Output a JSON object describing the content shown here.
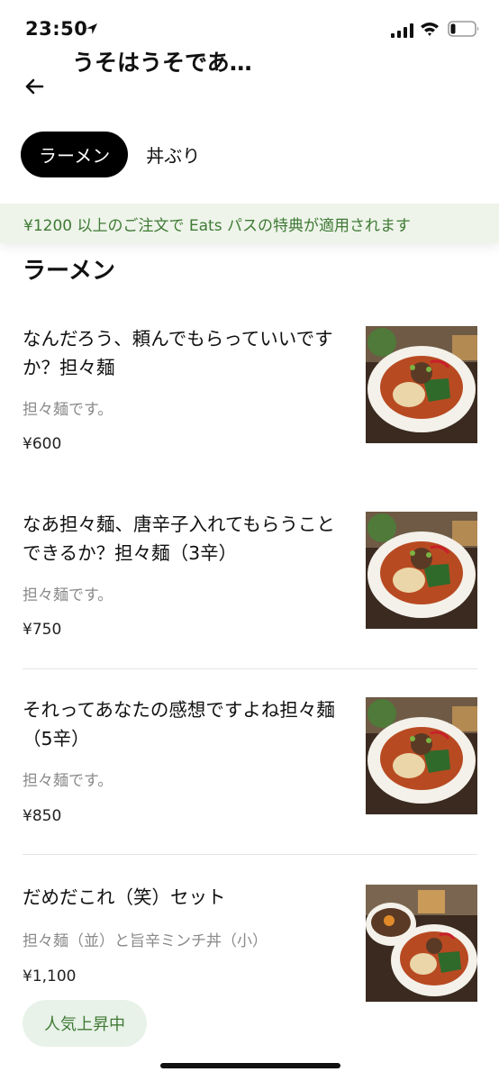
{
  "status_bar": {
    "time": "23:50"
  },
  "header": {
    "title": "うそはうそであ…"
  },
  "tabs": [
    {
      "label": "ラーメン",
      "active": true
    },
    {
      "label": "丼ぶり",
      "active": false
    }
  ],
  "promo": {
    "text": "¥1200 以上のご注文で Eats パスの特典が適用されます",
    "color": "#3f7a35",
    "background": "#eef4ea"
  },
  "section": {
    "title": "ラーメン"
  },
  "items": [
    {
      "name": "なんだろう、頼んでもらっていいですか？担々麺",
      "description": "担々麺です。",
      "price": "¥600",
      "image": "tantanmen-bowl"
    },
    {
      "name": "なあ担々麺、唐辛子入れてもらうことできるか？担々麺（3辛）",
      "description": "担々麺です。",
      "price": "¥750",
      "image": "tantanmen-bowl"
    },
    {
      "name": "それってあなたの感想ですよね担々麺（5辛）",
      "description": "担々麺です。",
      "price": "¥850",
      "image": "tantanmen-bowl"
    },
    {
      "name": "だめだこれ（笑）セット",
      "description": "担々麺（並）と旨辛ミンチ丼（小）",
      "price": "¥1,100",
      "image": "tantanmen-set",
      "badge": "人気上昇中"
    }
  ]
}
